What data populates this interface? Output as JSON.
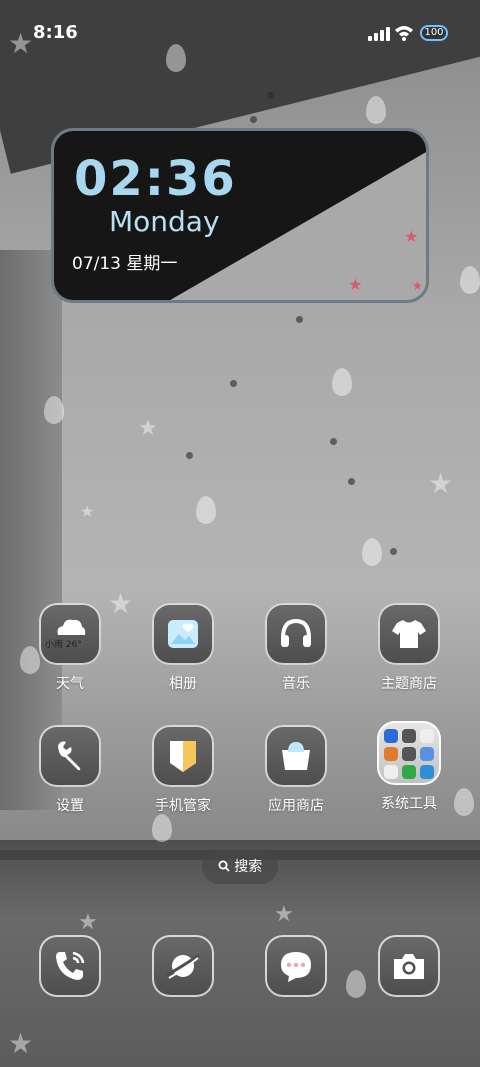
{
  "status_bar": {
    "time": "8:16",
    "battery": "100"
  },
  "widget": {
    "clock": "02:36",
    "day": "Monday",
    "date": "07/13  星期一"
  },
  "apps": {
    "weather": {
      "label": "天气",
      "badge": "小雨 26°"
    },
    "photos": {
      "label": "相册"
    },
    "music": {
      "label": "音乐"
    },
    "theme_store": {
      "label": "主题商店"
    },
    "settings": {
      "label": "设置"
    },
    "phone_manager": {
      "label": "手机管家"
    },
    "app_store": {
      "label": "应用商店"
    },
    "system_tools": {
      "label": "系统工具"
    }
  },
  "search": {
    "label": "搜索"
  },
  "dock": {
    "items": [
      "phone",
      "browser",
      "messages",
      "camera"
    ]
  },
  "colors": {
    "accent_blue": "#a8d8f0",
    "folder_bg": "#d9d9d9"
  }
}
